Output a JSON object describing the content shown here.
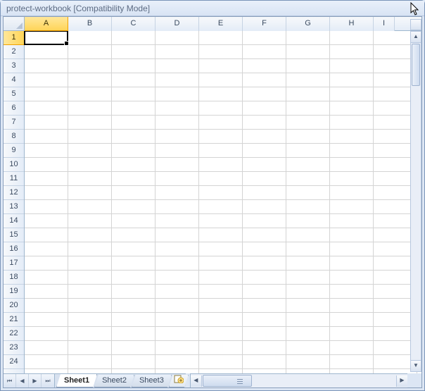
{
  "title": "protect-workbook  [Compatibility Mode]",
  "columns": [
    "A",
    "B",
    "C",
    "D",
    "E",
    "F",
    "G",
    "H",
    "I"
  ],
  "rows": [
    "1",
    "2",
    "3",
    "4",
    "5",
    "6",
    "7",
    "8",
    "9",
    "10",
    "11",
    "12",
    "13",
    "14",
    "15",
    "16",
    "17",
    "18",
    "19",
    "20",
    "21",
    "22",
    "23",
    "24"
  ],
  "active_cell": "A1",
  "active_column_index": 0,
  "active_row_index": 0,
  "tabs": [
    {
      "label": "Sheet1",
      "active": true
    },
    {
      "label": "Sheet2",
      "active": false
    },
    {
      "label": "Sheet3",
      "active": false
    }
  ],
  "nav_glyphs": {
    "first": "⏮",
    "prev": "◀",
    "next": "▶",
    "last": "⏭"
  },
  "scroll_glyphs": {
    "up": "▲",
    "down": "▼",
    "left": "◀",
    "right": "▶"
  }
}
